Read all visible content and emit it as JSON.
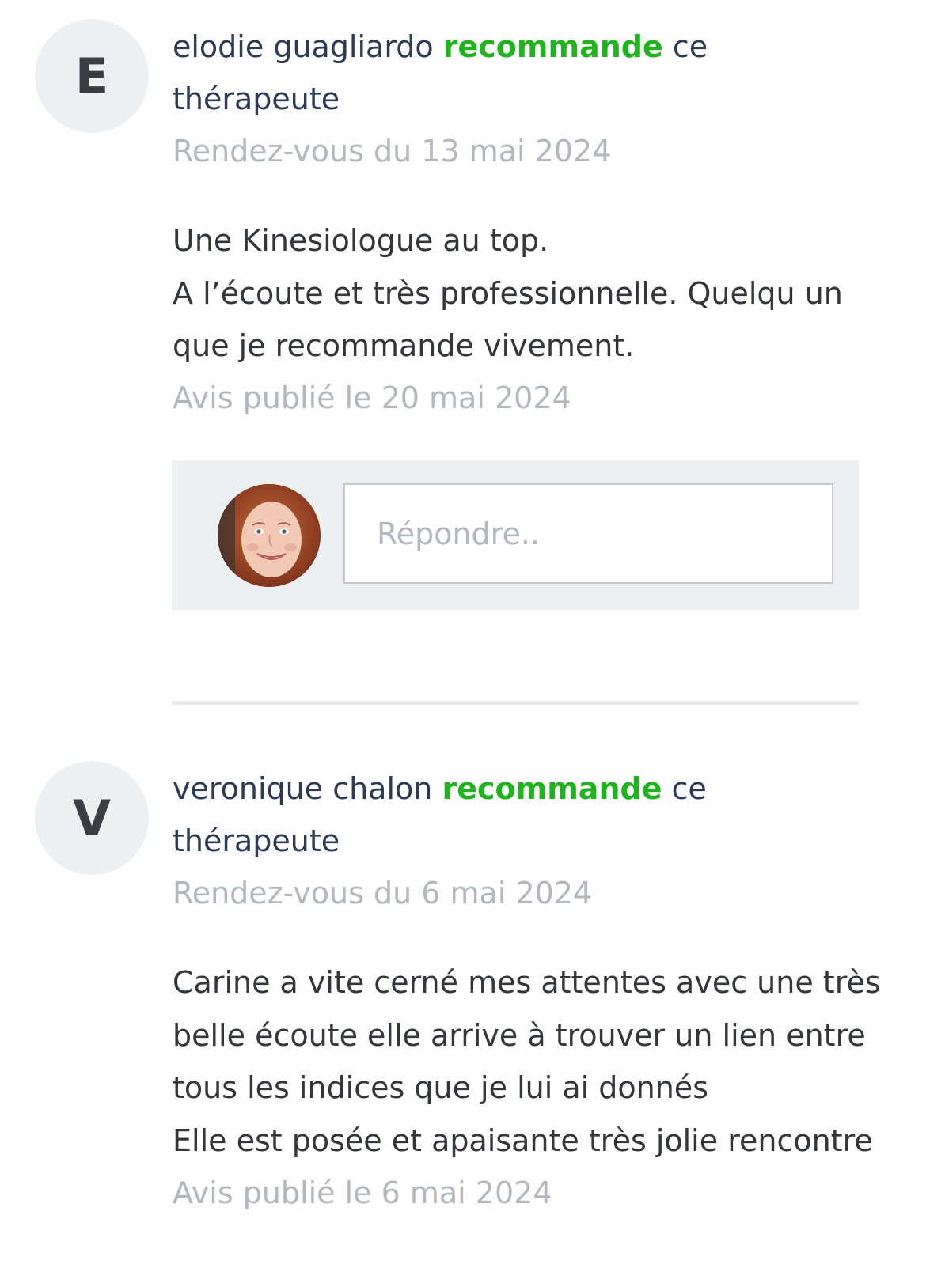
{
  "reviews": [
    {
      "initial": "E",
      "author_name": "elodie guagliardo",
      "recommend_word": "recommande",
      "recommend_suffix_line1": "ce",
      "recommend_suffix_line2": "thérapeute",
      "appointment_date": "Rendez-vous du 13 mai 2024",
      "body_lines": [
        "Une Kinesiologue au top.",
        "A l’écoute et très professionnelle. Quelqu un",
        "que je recommande vivement."
      ],
      "published": "Avis publié le 20 mai 2024"
    },
    {
      "initial": "V",
      "author_name": "veronique chalon",
      "recommend_word": "recommande",
      "recommend_suffix_line1": "ce",
      "recommend_suffix_line2": "thérapeute",
      "appointment_date": "Rendez-vous du 6 mai 2024",
      "body_lines": [
        "Carine a vite cerné mes attentes avec une très",
        "belle écoute elle arrive à trouver un lien entre",
        "tous les indices que je lui ai donnés",
        "Elle est posée et apaisante très jolie rencontre"
      ],
      "published": "Avis publié le 6 mai 2024"
    }
  ],
  "reply": {
    "placeholder": "Répondre..",
    "avatar_icon": "therapist-photo-avatar"
  },
  "colors": {
    "recommend_green": "#1fb41e",
    "author_navy": "#2b3a55",
    "muted_gray": "#b3b8bf",
    "panel_bg": "#edf0f3"
  }
}
